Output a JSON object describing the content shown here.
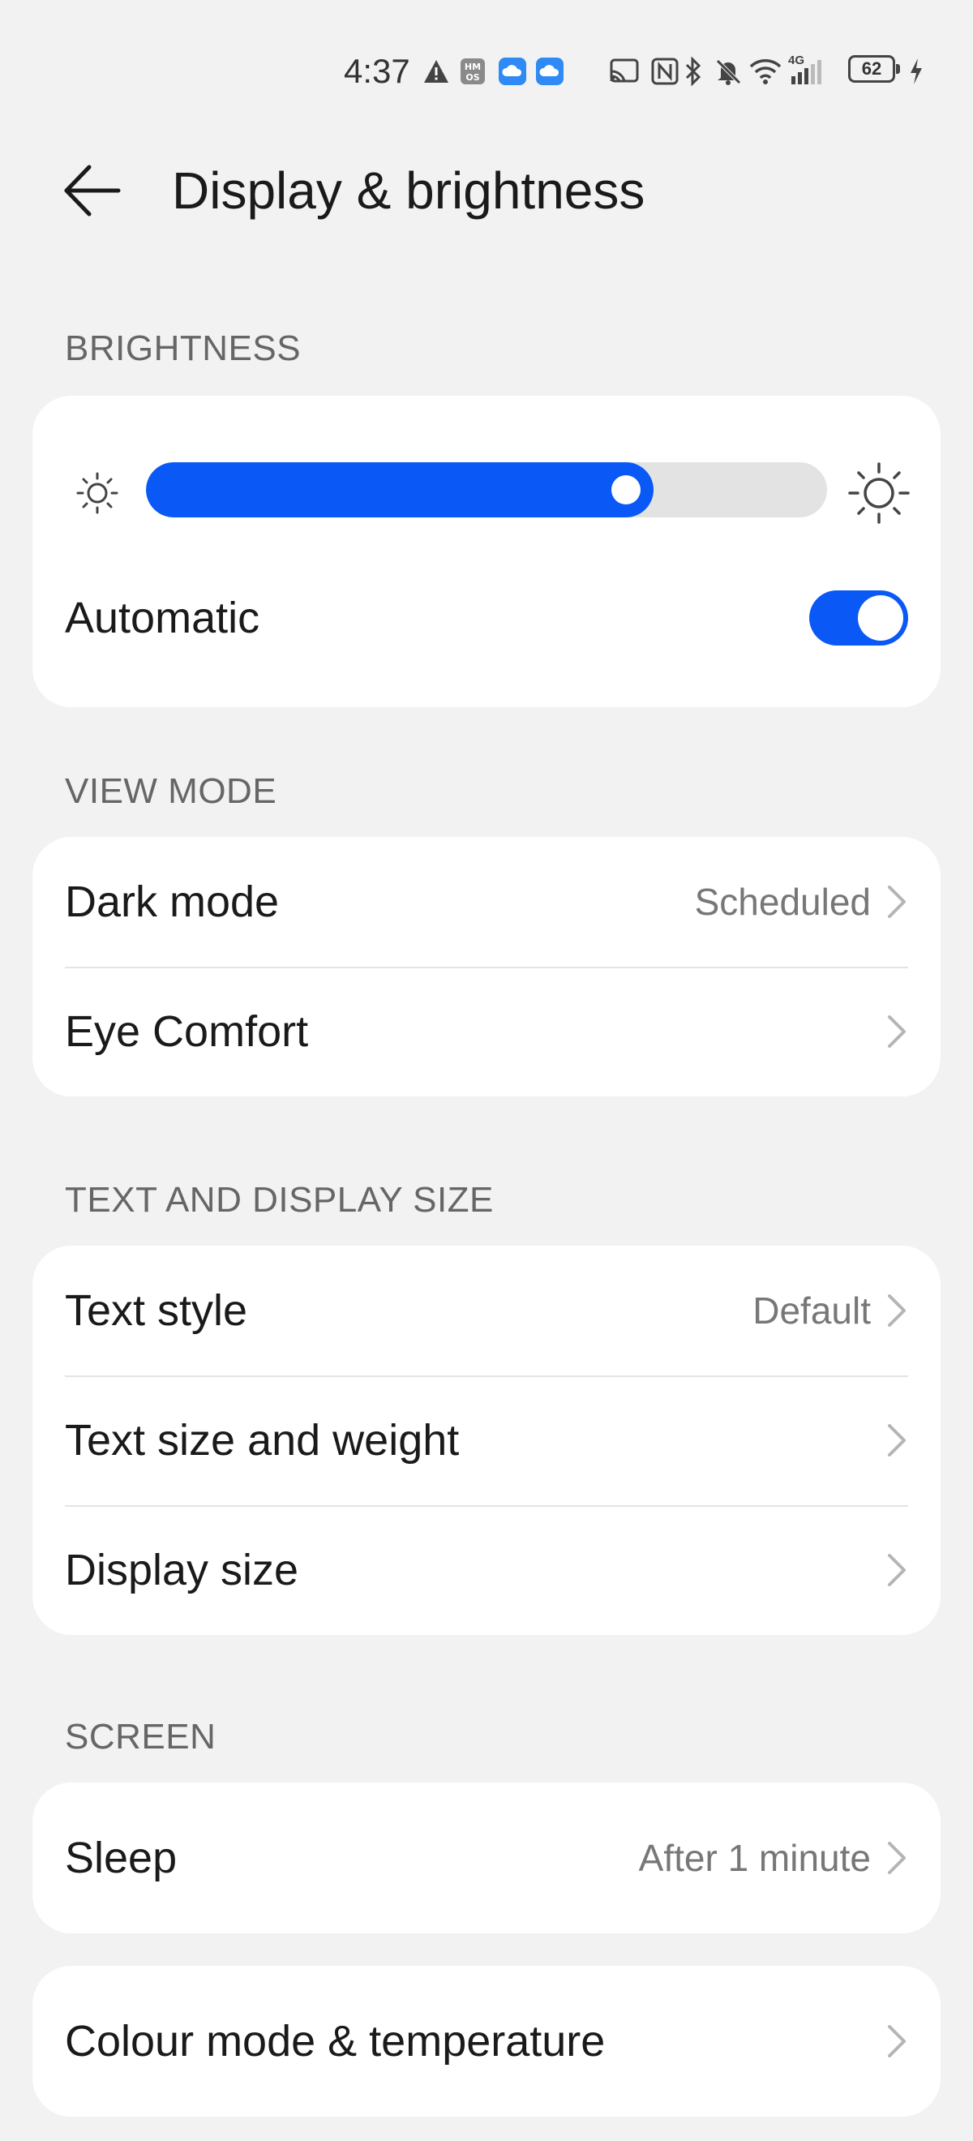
{
  "status_bar": {
    "time": "4:37",
    "battery": "62",
    "icons": [
      "alert-icon",
      "hmos-icon",
      "cloud-icon",
      "cloud-icon",
      "cast-icon",
      "nfc-icon",
      "bluetooth-icon",
      "mute-icon",
      "wifi-icon",
      "signal-icon",
      "charging-icon"
    ],
    "network_label": "4G"
  },
  "header": {
    "title": "Display & brightness",
    "back_icon": "back-arrow-icon"
  },
  "brightness": {
    "section_title": "BRIGHTNESS",
    "level": 0.745,
    "automatic_label": "Automatic",
    "automatic_on": true,
    "accent_color": "#0a59f7"
  },
  "view_mode": {
    "section_title": "VIEW MODE",
    "items": [
      {
        "label": "Dark mode",
        "value": "Scheduled"
      },
      {
        "label": "Eye Comfort",
        "value": ""
      }
    ]
  },
  "text_display": {
    "section_title": "TEXT AND DISPLAY SIZE",
    "items": [
      {
        "label": "Text style",
        "value": "Default"
      },
      {
        "label": "Text size and weight",
        "value": ""
      },
      {
        "label": "Display size",
        "value": ""
      }
    ]
  },
  "screen": {
    "section_title": "SCREEN",
    "items": [
      {
        "label": "Sleep",
        "value": "After 1 minute"
      }
    ]
  },
  "colour": {
    "items": [
      {
        "label": "Colour mode & temperature",
        "value": ""
      }
    ]
  }
}
